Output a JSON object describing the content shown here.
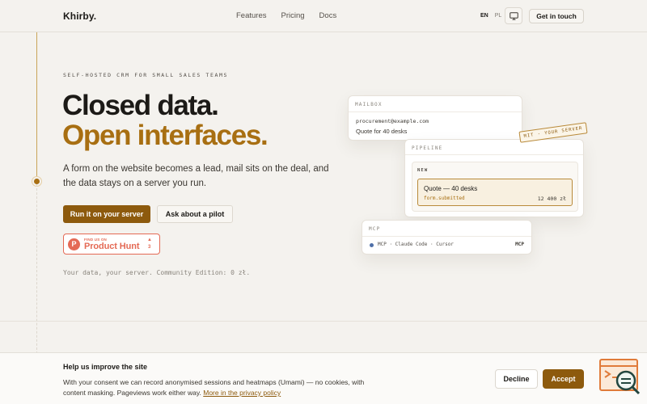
{
  "header": {
    "logo": "Khirby.",
    "nav": [
      "Features",
      "Pricing",
      "Docs"
    ],
    "lang_active": "EN",
    "lang_other": "PL",
    "cta": "Get in touch"
  },
  "hero": {
    "eyebrow": "SELF-HOSTED CRM FOR SMALL SALES TEAMS",
    "headline_1": "Closed data.",
    "headline_2": "Open interfaces.",
    "lede": "A form on the website becomes a lead, mail sits on the deal, and the data stays on a server you run.",
    "primary_cta": "Run it on your server",
    "secondary_cta": "Ask about a pilot",
    "product_hunt": {
      "small": "FIND US ON",
      "big": "Product Hunt",
      "count": "3"
    },
    "footnote": "Your data, your server. Community Edition: 0 zł."
  },
  "cards": {
    "mailbox": {
      "label": "MAILBOX",
      "from": "procurement@example.com",
      "subject": "Quote for 40 desks"
    },
    "badge": "MIT · YOUR SERVER",
    "pipeline": {
      "label": "PIPELINE",
      "stage": "NEW",
      "deal_title": "Quote — 40 desks",
      "deal_event": "form.submitted",
      "deal_amount": "12 400 zł"
    },
    "mcp": {
      "label": "MCP",
      "clients": "MCP · Claude Code · Cursor",
      "tag": "MCP"
    }
  },
  "cookie": {
    "title": "Help us improve the site",
    "text": "With your consent we can record anonymised sessions and heatmaps (Umami) — no cookies, with content masking. Pageviews work either way.",
    "link": "More in the privacy policy",
    "decline": "Decline",
    "accept": "Accept"
  },
  "colors": {
    "accent": "#a86f12",
    "accent_dark": "#8d5a0d",
    "product_hunt": "#e46a55",
    "background": "#f4f2ee"
  },
  "icons": {
    "theme_toggle": "monitor-icon",
    "product_hunt": "product-hunt-logo-icon",
    "widget": "terminal-search-icon"
  }
}
